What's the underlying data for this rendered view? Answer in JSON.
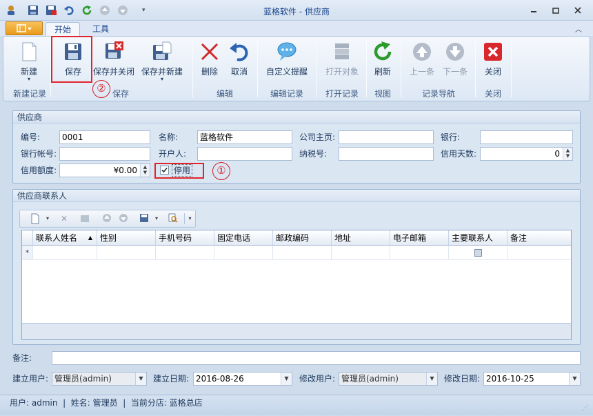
{
  "window": {
    "title": "蓝格软件 - 供应商"
  },
  "ribbon_tabs": {
    "app_menu": "",
    "tab_start": "开始",
    "tab_tools": "工具"
  },
  "ribbon": {
    "new": "新建",
    "save": "保存",
    "save_close": "保存并关闭",
    "save_new": "保存并新建",
    "delete": "删除",
    "cancel": "取消",
    "custom_alert": "自定义提醒",
    "open_object": "打开对象",
    "refresh": "刷新",
    "prev": "上一条",
    "next": "下一条",
    "close": "关闭",
    "groups": {
      "new_record": "新建记录",
      "save": "保存",
      "edit": "编辑",
      "edit_record": "编辑记录",
      "open_record": "打开记录",
      "view": "视图",
      "nav": "记录导航",
      "close": "关闭"
    }
  },
  "annotations": {
    "one": "①",
    "two": "②"
  },
  "supplier": {
    "title": "供应商",
    "code_label": "编号:",
    "code": "0001",
    "name_label": "名称:",
    "name": "蓝格软件",
    "homepage_label": "公司主页:",
    "homepage": "",
    "bank_label": "银行:",
    "bank": "",
    "account_label": "银行帐号:",
    "account": "",
    "holder_label": "开户人:",
    "holder": "",
    "tax_label": "纳税号:",
    "tax": "",
    "credit_days_label": "信用天数:",
    "credit_days": "0",
    "credit_limit_label": "信用额度:",
    "credit_limit": "¥0.00",
    "disabled_label": "停用",
    "disabled": true
  },
  "contacts": {
    "title": "供应商联系人",
    "columns": [
      "联系人姓名",
      "性别",
      "手机号码",
      "固定电话",
      "邮政编码",
      "地址",
      "电子邮箱",
      "主要联系人",
      "备注"
    ],
    "new_row_marker": "*"
  },
  "footer": {
    "remark_label": "备注:",
    "remark": "",
    "creator_label": "建立用户:",
    "creator": "管理员(admin)",
    "created_label": "建立日期:",
    "created": "2016-08-26",
    "modifier_label": "修改用户:",
    "modifier": "管理员(admin)",
    "modified_label": "修改日期:",
    "modified": "2016-10-25"
  },
  "status": {
    "text": "用户: admin  |  姓名: 管理员  |  当前分店: 蓝格总店"
  }
}
